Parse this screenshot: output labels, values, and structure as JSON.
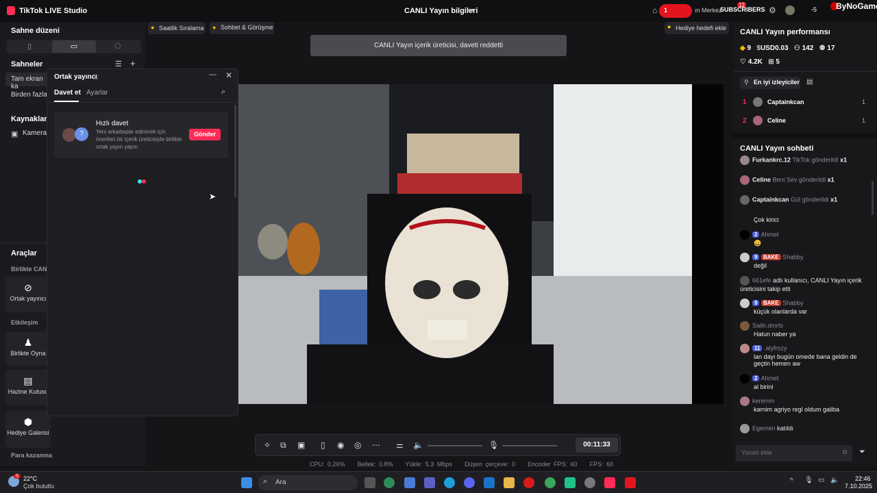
{
  "header": {
    "app_title": "TikTok LIVE Studio",
    "stream_title": "CANLI Yayın bilgileri",
    "notif_count": "1",
    "center_text": "ın Merkez",
    "center_badge": "12",
    "subscribers": "SUBSCRIBERS",
    "minus_count": "-5",
    "watermark": "ByNoGame"
  },
  "left_panel": {
    "scene_layout_title": "Sahne düzeni",
    "scenes_title": "Sahneler",
    "scene_items": [
      "Tam ekran ka",
      "Birden fazla"
    ],
    "sources_title": "Kaynaklar",
    "source_item": "Kamera",
    "tools_title": "Araçlar",
    "together_sub": "Birlikte CANL",
    "cohost_label": "Ortak yayıncı",
    "interaction_sub": "Etkileşim",
    "play_together_label": "Birlikte Oyna",
    "treasure_label": "Hazine Kutusu",
    "gift_gallery_label": "Hediye Galerisi",
    "earn_sub": "Para kazanma"
  },
  "top_chips": {
    "hourly_rank": "Saatlik Sıralama",
    "chat_meet": "Sohbet & Görüşme",
    "gift_goal": "Hediye hedefi ekle"
  },
  "toast": "CANLI Yayın içerik üreticisi, daveti reddetti",
  "dialog": {
    "title": "Ortak yayıncı",
    "tab_invite": "Davet et",
    "tab_settings": "Ayarlar",
    "quick_title": "Hızlı davet",
    "quick_desc": "Yeni arkadaşlar edinmek için önerilen bir içerik üreticisiyle birlikte ortak yayın yapın",
    "send_button": "Gönder"
  },
  "right_panel": {
    "perf_title": "CANLI Yayın performansı",
    "coins": "9",
    "usd": "USD0.03",
    "viewers": "142",
    "followers": "17",
    "likes": "4.2K",
    "gifts": "5",
    "top_viewers_btn": "En iyi izleyiciler",
    "top_viewers": [
      {
        "rank": "1",
        "name": "Captainkcan",
        "count": "1"
      },
      {
        "rank": "2",
        "name": "Celine",
        "count": "1"
      }
    ],
    "chat_title": "CANLI Yayın sohbeti",
    "gift_rows": [
      {
        "name": "Furkankrc.12",
        "text": "TikTok gönderildi",
        "count": "x1"
      },
      {
        "name": "Celine",
        "text": "Beni Sev gönderildi",
        "count": "x1"
      },
      {
        "name": "Captainkcan",
        "text": "Gül gönderildi",
        "count": "x1"
      }
    ],
    "chat": [
      {
        "user": "",
        "badge": "",
        "msg": "Çok kirici"
      },
      {
        "user": "Ahmet",
        "badge": "2",
        "msg": "😄"
      },
      {
        "user": "Shabby",
        "badge": "9",
        "badge2": "BAKE",
        "msg": "değil"
      },
      {
        "user": "661efe",
        "badge": "",
        "msg": "adlı kullanıcı, CANLI Yayın içerik üreticisini takip etti"
      },
      {
        "user": "Shabby",
        "badge": "9",
        "badge2": "BAKE",
        "msg": "küçük olanlarda var"
      },
      {
        "user": "Salih.dmrts",
        "badge": "",
        "msg": "Hatun naber ya"
      },
      {
        "user": ".alyfrozy",
        "badge": "11",
        "msg": "lan dayı bugün omede bana geldin de geçtin hemen aw"
      },
      {
        "user": "Ahmet",
        "badge": "2",
        "msg": "al birini"
      },
      {
        "user": "keremm",
        "badge": "",
        "msg": "karnim agriyo regl oldum galiba"
      },
      {
        "user": "Egemen",
        "badge": "",
        "msg": "katıldı"
      }
    ],
    "comment_placeholder": "Yorum ekle"
  },
  "control_bar": {
    "timer": "00:11:33"
  },
  "stats": {
    "cpu": "CPU: 0.26%",
    "mem": "Bellek: 0.8%",
    "upload": "Yükle: 5.3 Mbps",
    "dropped": "Düşen çerçeve: 0",
    "enc_fps": "Encoder FPS: 60",
    "fps": "FPS: 60"
  },
  "taskbar": {
    "temp": "22°C",
    "weather": "Çok bulutlu",
    "weather_badge": "5",
    "search": "Ara",
    "time": "22:46",
    "date": "7.10.2025"
  },
  "colors": {
    "accent": "#fe2c55",
    "bg": "#151518"
  }
}
